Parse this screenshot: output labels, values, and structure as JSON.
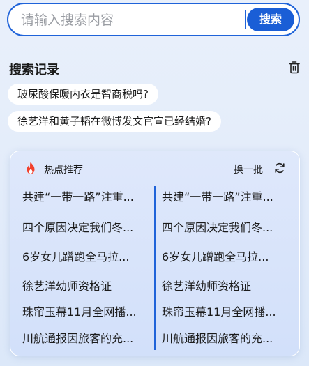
{
  "search": {
    "placeholder": "请输入搜索内容",
    "button_label": "搜索"
  },
  "history": {
    "title": "搜索记录",
    "items": [
      "玻尿酸保暖内衣是智商税吗?",
      "徐艺洋和黄子韬在微博发文官宣已经结婚?"
    ]
  },
  "hot": {
    "title": "热点推荐",
    "refresh_label": "换一批",
    "left_items": [
      "共建“一带一路”注重...",
      "四个原因决定我们冬...",
      "6岁女儿蹭跑全马拉...",
      "徐艺洋幼师资格证",
      "珠帘玉幕11月全网播...",
      "川航通报因旅客的充..."
    ],
    "right_items": [
      "共建“一带一路”注重...",
      "四个原因决定我们冬...",
      "6岁女儿蹭跑全马拉...",
      "徐艺洋幼师资格证",
      "珠帘玉幕11月全网播...",
      "川航通报因旅客的充..."
    ]
  },
  "colors": {
    "accent": "#1f63d9",
    "button": "#1a5ed6",
    "fire": "#f2402c"
  },
  "icons": {
    "delete": "trash-icon",
    "hot": "fire-icon",
    "refresh": "refresh-icon"
  }
}
